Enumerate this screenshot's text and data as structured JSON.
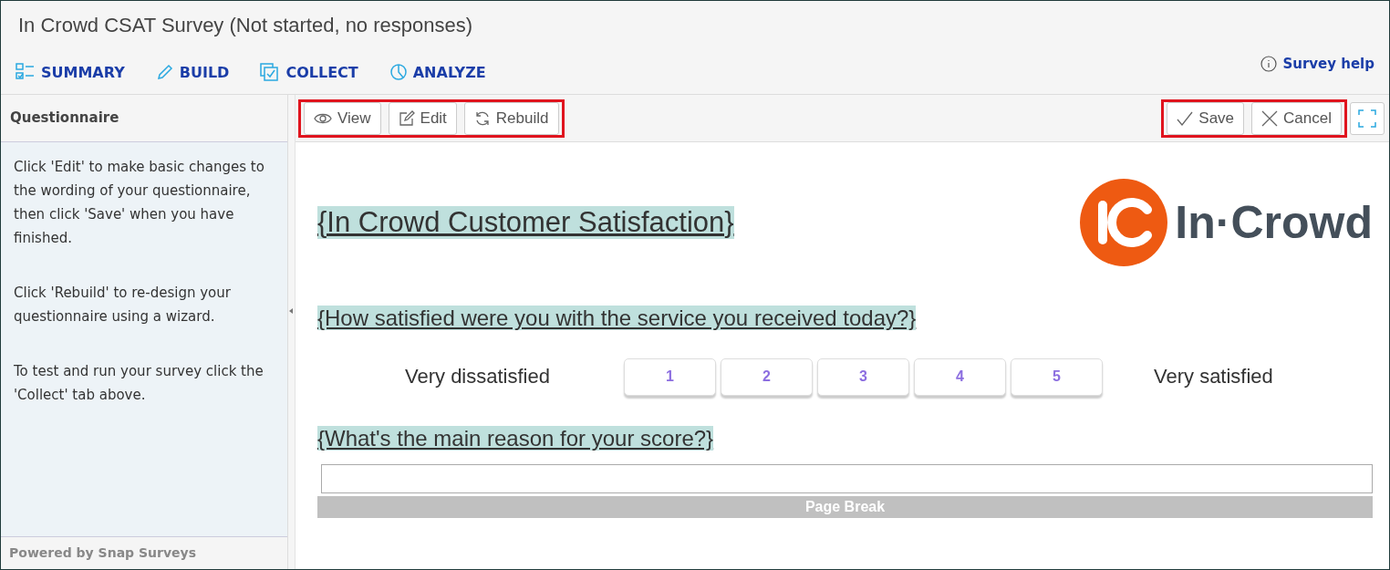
{
  "window": {
    "title": "In Crowd CSAT Survey (Not started, no responses)"
  },
  "nav": {
    "items": [
      {
        "label": "SUMMARY"
      },
      {
        "label": "BUILD"
      },
      {
        "label": "COLLECT"
      },
      {
        "label": "ANALYZE"
      }
    ],
    "help": "Survey help"
  },
  "sidebar": {
    "title": "Questionnaire",
    "paragraphs": [
      "Click 'Edit' to make basic changes to the wording of your questionnaire, then click 'Save' when you have finished.",
      "Click 'Rebuild' to re-design your questionnaire using a wizard.",
      "To test and run your survey click the 'Collect' tab above."
    ],
    "footer": "Powered by Snap Surveys"
  },
  "toolbar": {
    "left": [
      "View",
      "Edit",
      "Rebuild"
    ],
    "right": [
      "Save",
      "Cancel"
    ]
  },
  "survey": {
    "title": "{In Crowd Customer Satisfaction}",
    "logo_text": "In·Crowd",
    "questions": [
      {
        "kind": "scale",
        "text": "{How satisfied were you with the service you received today?}",
        "low": "Very dissatisfied",
        "high": "Very satisfied",
        "options": [
          "1",
          "2",
          "3",
          "4",
          "5"
        ]
      },
      {
        "kind": "text",
        "text": "{What's the main reason for your score?}"
      }
    ],
    "page_break": "Page Break"
  }
}
